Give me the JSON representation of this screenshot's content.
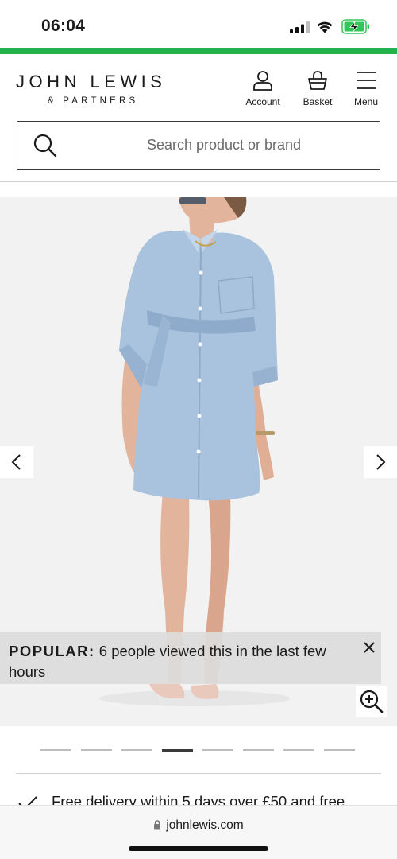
{
  "status_bar": {
    "time": "06:04",
    "icons": [
      "cellular-signal-icon",
      "wifi-icon",
      "battery-charging-icon"
    ]
  },
  "colors": {
    "accent_line": "#24b24f",
    "battery_fill": "#32c759",
    "denim": "#a9c3de",
    "gallery_bg": "#f2f2f2"
  },
  "header": {
    "logo_main": "JOHN LEWIS",
    "logo_sub": "& PARTNERS",
    "account_label": "Account",
    "basket_label": "Basket",
    "menu_label": "Menu"
  },
  "search": {
    "placeholder": "Search product or brand",
    "value": ""
  },
  "gallery": {
    "image_subject": "model-in-denim-shirt-dress",
    "popular_label": "POPULAR:",
    "popular_text": "6 people viewed this in the last few hours",
    "dots_count": 8,
    "active_dot": 4
  },
  "delivery": {
    "text": "Free delivery within 5 days over £50 and free"
  },
  "browser": {
    "url": "johnlewis.com"
  }
}
